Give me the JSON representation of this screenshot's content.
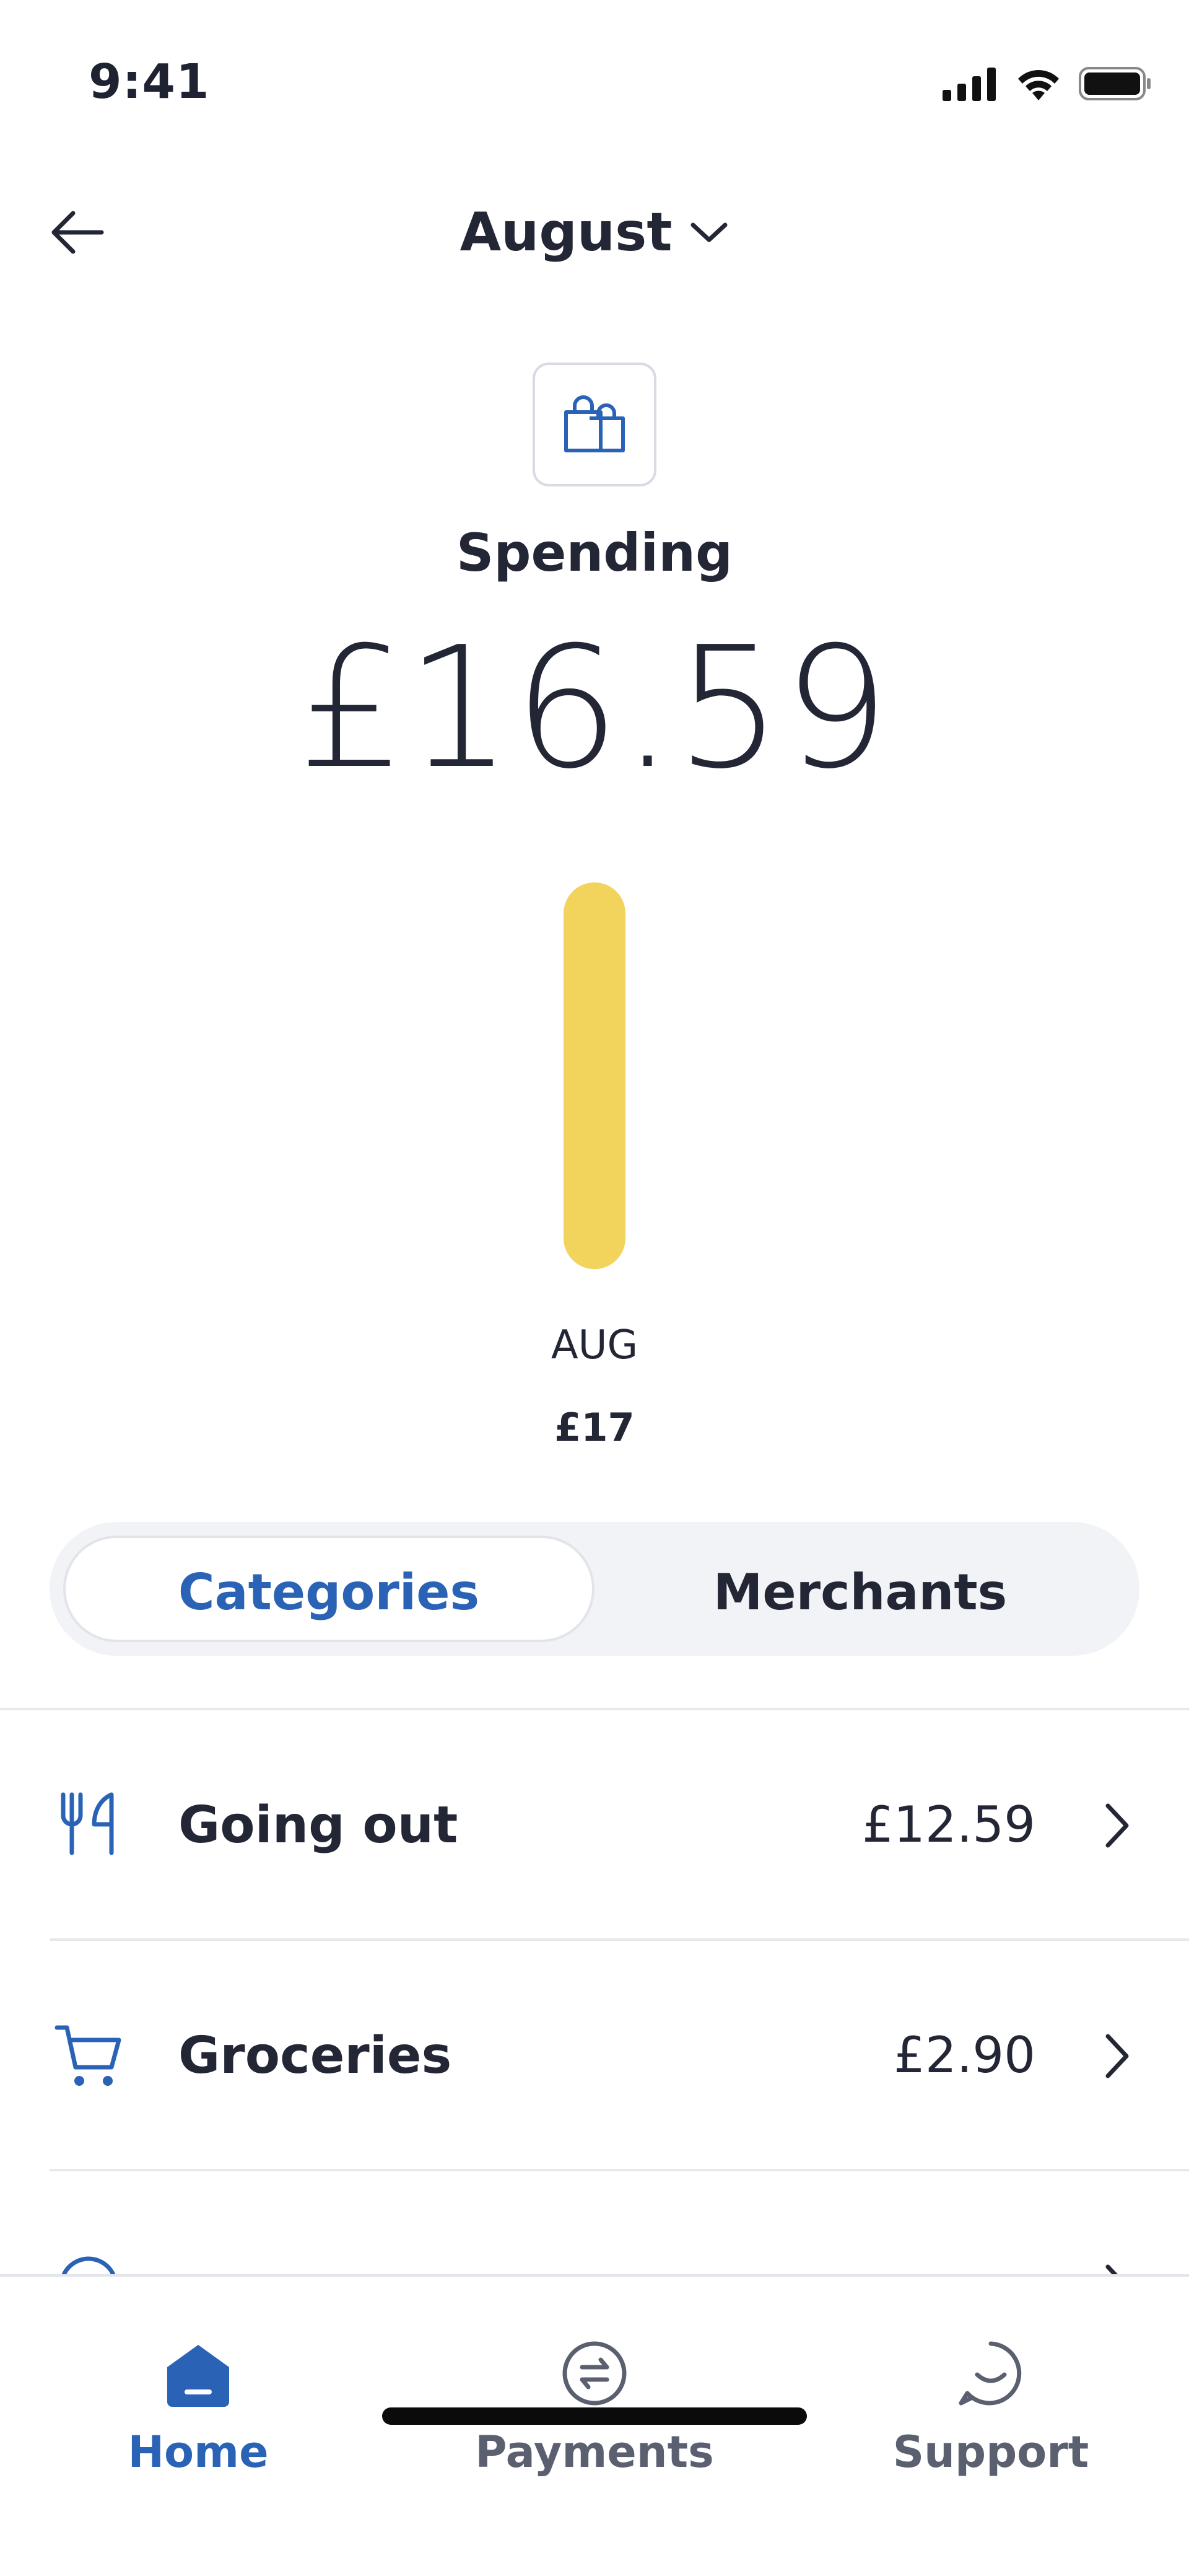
{
  "status_bar": {
    "time": "9:41"
  },
  "header": {
    "month": "August"
  },
  "summary": {
    "title": "Spending",
    "amount": "£16.59"
  },
  "chart_data": {
    "type": "bar",
    "categories": [
      "AUG"
    ],
    "values": [
      16.59
    ],
    "value_labels": [
      "£17"
    ],
    "bar_color": "#f2d35b"
  },
  "segments": {
    "categories_label": "Categories",
    "merchants_label": "Merchants",
    "selected": "Categories"
  },
  "categories": [
    {
      "icon": "cutlery-icon",
      "label": "Going out",
      "amount": "£12.59"
    },
    {
      "icon": "cart-icon",
      "label": "Groceries",
      "amount": "£2.90"
    }
  ],
  "tabs": [
    {
      "icon": "home-icon",
      "label": "Home",
      "active": true
    },
    {
      "icon": "payments-icon",
      "label": "Payments",
      "active": false
    },
    {
      "icon": "support-icon",
      "label": "Support",
      "active": false
    }
  ],
  "colors": {
    "accent": "#2a63b5",
    "text": "#232635",
    "muted": "#5a6070",
    "bar": "#f2d35b"
  }
}
